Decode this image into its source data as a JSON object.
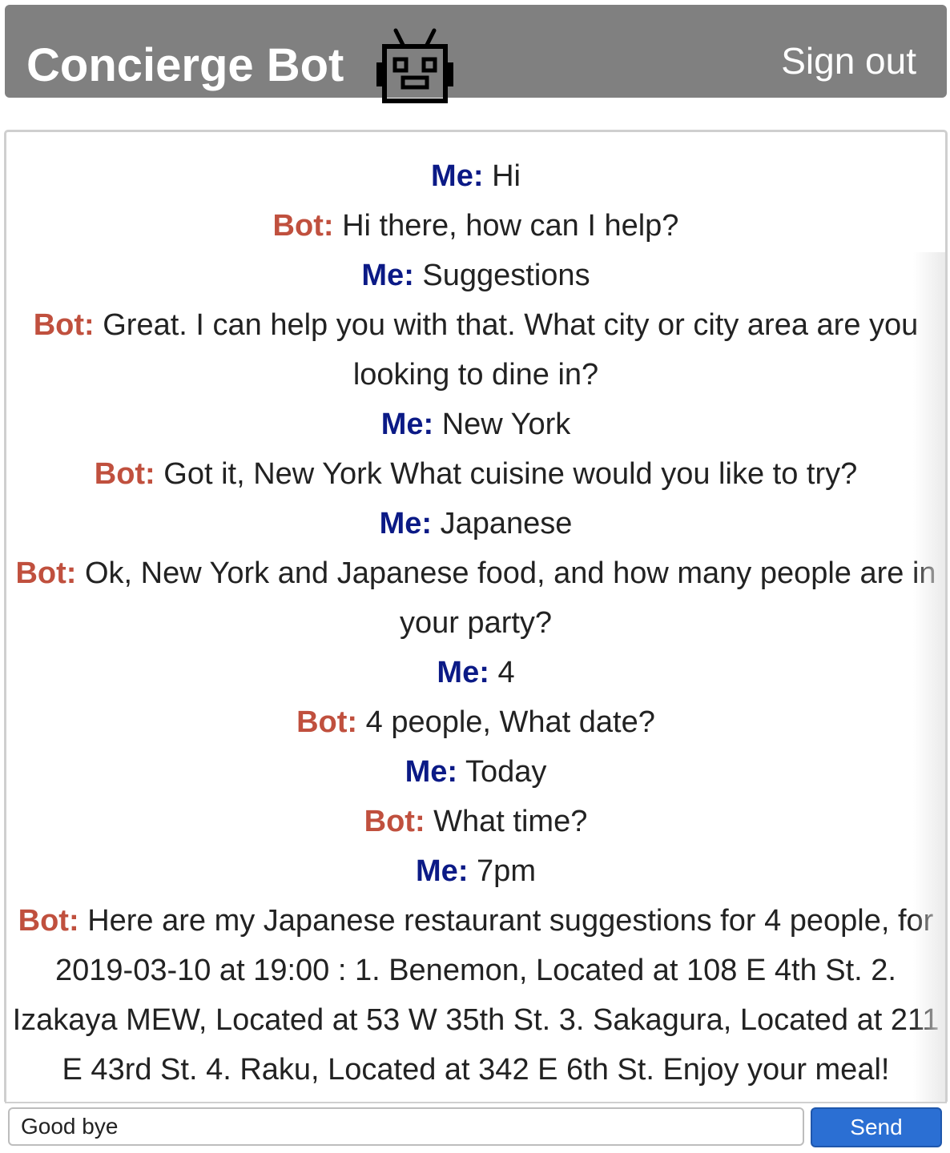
{
  "header": {
    "title": "Concierge Bot",
    "signout_label": "Sign out",
    "icon": "robot-icon",
    "background_color": "#808080"
  },
  "colors": {
    "bot_label": "#c0503e",
    "me_label": "#0b1a86",
    "send_button": "#2b6fd3"
  },
  "conversation": [
    {
      "speaker": "Me:",
      "role": "me",
      "text": "Hi"
    },
    {
      "speaker": "Bot:",
      "role": "bot",
      "text": "Hi there, how can I help?"
    },
    {
      "speaker": "Me:",
      "role": "me",
      "text": "Suggestions"
    },
    {
      "speaker": "Bot:",
      "role": "bot",
      "text": "Great. I can help you with that. What city or city area are you looking to dine in?"
    },
    {
      "speaker": "Me:",
      "role": "me",
      "text": "New York"
    },
    {
      "speaker": "Bot:",
      "role": "bot",
      "text": "Got it, New York What cuisine would you like to try?"
    },
    {
      "speaker": "Me:",
      "role": "me",
      "text": "Japanese"
    },
    {
      "speaker": "Bot:",
      "role": "bot",
      "text": "Ok, New York and Japanese food, and how many people are in your party?"
    },
    {
      "speaker": "Me:",
      "role": "me",
      "text": "4"
    },
    {
      "speaker": "Bot:",
      "role": "bot",
      "text": "4 people, What date?"
    },
    {
      "speaker": "Me:",
      "role": "me",
      "text": "Today"
    },
    {
      "speaker": "Bot:",
      "role": "bot",
      "text": "What time?"
    },
    {
      "speaker": "Me:",
      "role": "me",
      "text": "7pm"
    },
    {
      "speaker": "Bot:",
      "role": "bot",
      "text": "Here are my Japanese restaurant suggestions for 4 people, for 2019-03-10 at 19:00 : 1. Benemon, Located at 108 E 4th St. 2. Izakaya MEW, Located at 53 W 35th St. 3. Sakagura, Located at 211 E 43rd St. 4. Raku, Located at 342 E 6th St. Enjoy your meal!"
    }
  ],
  "composer": {
    "input_value": "Good bye",
    "send_label": "Send"
  }
}
